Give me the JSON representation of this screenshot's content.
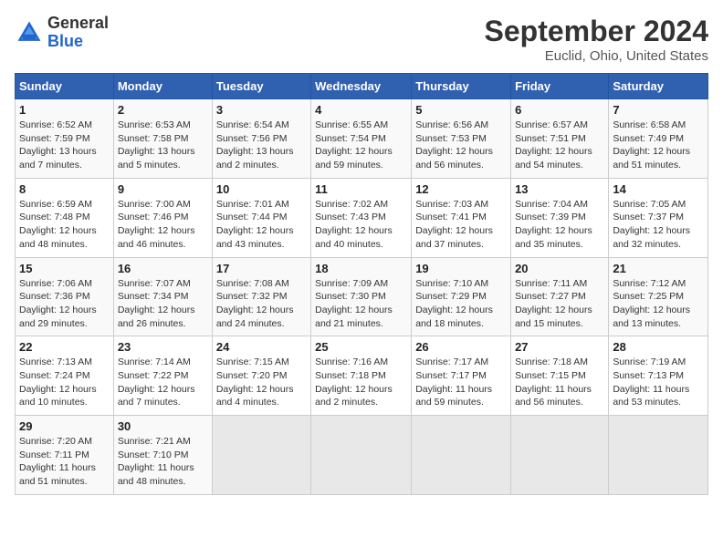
{
  "header": {
    "logo_general": "General",
    "logo_blue": "Blue",
    "title": "September 2024",
    "location": "Euclid, Ohio, United States"
  },
  "days_of_week": [
    "Sunday",
    "Monday",
    "Tuesday",
    "Wednesday",
    "Thursday",
    "Friday",
    "Saturday"
  ],
  "weeks": [
    [
      {
        "day": "1",
        "info": "Sunrise: 6:52 AM\nSunset: 7:59 PM\nDaylight: 13 hours\nand 7 minutes."
      },
      {
        "day": "2",
        "info": "Sunrise: 6:53 AM\nSunset: 7:58 PM\nDaylight: 13 hours\nand 5 minutes."
      },
      {
        "day": "3",
        "info": "Sunrise: 6:54 AM\nSunset: 7:56 PM\nDaylight: 13 hours\nand 2 minutes."
      },
      {
        "day": "4",
        "info": "Sunrise: 6:55 AM\nSunset: 7:54 PM\nDaylight: 12 hours\nand 59 minutes."
      },
      {
        "day": "5",
        "info": "Sunrise: 6:56 AM\nSunset: 7:53 PM\nDaylight: 12 hours\nand 56 minutes."
      },
      {
        "day": "6",
        "info": "Sunrise: 6:57 AM\nSunset: 7:51 PM\nDaylight: 12 hours\nand 54 minutes."
      },
      {
        "day": "7",
        "info": "Sunrise: 6:58 AM\nSunset: 7:49 PM\nDaylight: 12 hours\nand 51 minutes."
      }
    ],
    [
      {
        "day": "8",
        "info": "Sunrise: 6:59 AM\nSunset: 7:48 PM\nDaylight: 12 hours\nand 48 minutes."
      },
      {
        "day": "9",
        "info": "Sunrise: 7:00 AM\nSunset: 7:46 PM\nDaylight: 12 hours\nand 46 minutes."
      },
      {
        "day": "10",
        "info": "Sunrise: 7:01 AM\nSunset: 7:44 PM\nDaylight: 12 hours\nand 43 minutes."
      },
      {
        "day": "11",
        "info": "Sunrise: 7:02 AM\nSunset: 7:43 PM\nDaylight: 12 hours\nand 40 minutes."
      },
      {
        "day": "12",
        "info": "Sunrise: 7:03 AM\nSunset: 7:41 PM\nDaylight: 12 hours\nand 37 minutes."
      },
      {
        "day": "13",
        "info": "Sunrise: 7:04 AM\nSunset: 7:39 PM\nDaylight: 12 hours\nand 35 minutes."
      },
      {
        "day": "14",
        "info": "Sunrise: 7:05 AM\nSunset: 7:37 PM\nDaylight: 12 hours\nand 32 minutes."
      }
    ],
    [
      {
        "day": "15",
        "info": "Sunrise: 7:06 AM\nSunset: 7:36 PM\nDaylight: 12 hours\nand 29 minutes."
      },
      {
        "day": "16",
        "info": "Sunrise: 7:07 AM\nSunset: 7:34 PM\nDaylight: 12 hours\nand 26 minutes."
      },
      {
        "day": "17",
        "info": "Sunrise: 7:08 AM\nSunset: 7:32 PM\nDaylight: 12 hours\nand 24 minutes."
      },
      {
        "day": "18",
        "info": "Sunrise: 7:09 AM\nSunset: 7:30 PM\nDaylight: 12 hours\nand 21 minutes."
      },
      {
        "day": "19",
        "info": "Sunrise: 7:10 AM\nSunset: 7:29 PM\nDaylight: 12 hours\nand 18 minutes."
      },
      {
        "day": "20",
        "info": "Sunrise: 7:11 AM\nSunset: 7:27 PM\nDaylight: 12 hours\nand 15 minutes."
      },
      {
        "day": "21",
        "info": "Sunrise: 7:12 AM\nSunset: 7:25 PM\nDaylight: 12 hours\nand 13 minutes."
      }
    ],
    [
      {
        "day": "22",
        "info": "Sunrise: 7:13 AM\nSunset: 7:24 PM\nDaylight: 12 hours\nand 10 minutes."
      },
      {
        "day": "23",
        "info": "Sunrise: 7:14 AM\nSunset: 7:22 PM\nDaylight: 12 hours\nand 7 minutes."
      },
      {
        "day": "24",
        "info": "Sunrise: 7:15 AM\nSunset: 7:20 PM\nDaylight: 12 hours\nand 4 minutes."
      },
      {
        "day": "25",
        "info": "Sunrise: 7:16 AM\nSunset: 7:18 PM\nDaylight: 12 hours\nand 2 minutes."
      },
      {
        "day": "26",
        "info": "Sunrise: 7:17 AM\nSunset: 7:17 PM\nDaylight: 11 hours\nand 59 minutes."
      },
      {
        "day": "27",
        "info": "Sunrise: 7:18 AM\nSunset: 7:15 PM\nDaylight: 11 hours\nand 56 minutes."
      },
      {
        "day": "28",
        "info": "Sunrise: 7:19 AM\nSunset: 7:13 PM\nDaylight: 11 hours\nand 53 minutes."
      }
    ],
    [
      {
        "day": "29",
        "info": "Sunrise: 7:20 AM\nSunset: 7:11 PM\nDaylight: 11 hours\nand 51 minutes."
      },
      {
        "day": "30",
        "info": "Sunrise: 7:21 AM\nSunset: 7:10 PM\nDaylight: 11 hours\nand 48 minutes."
      },
      {
        "day": "",
        "info": ""
      },
      {
        "day": "",
        "info": ""
      },
      {
        "day": "",
        "info": ""
      },
      {
        "day": "",
        "info": ""
      },
      {
        "day": "",
        "info": ""
      }
    ]
  ]
}
